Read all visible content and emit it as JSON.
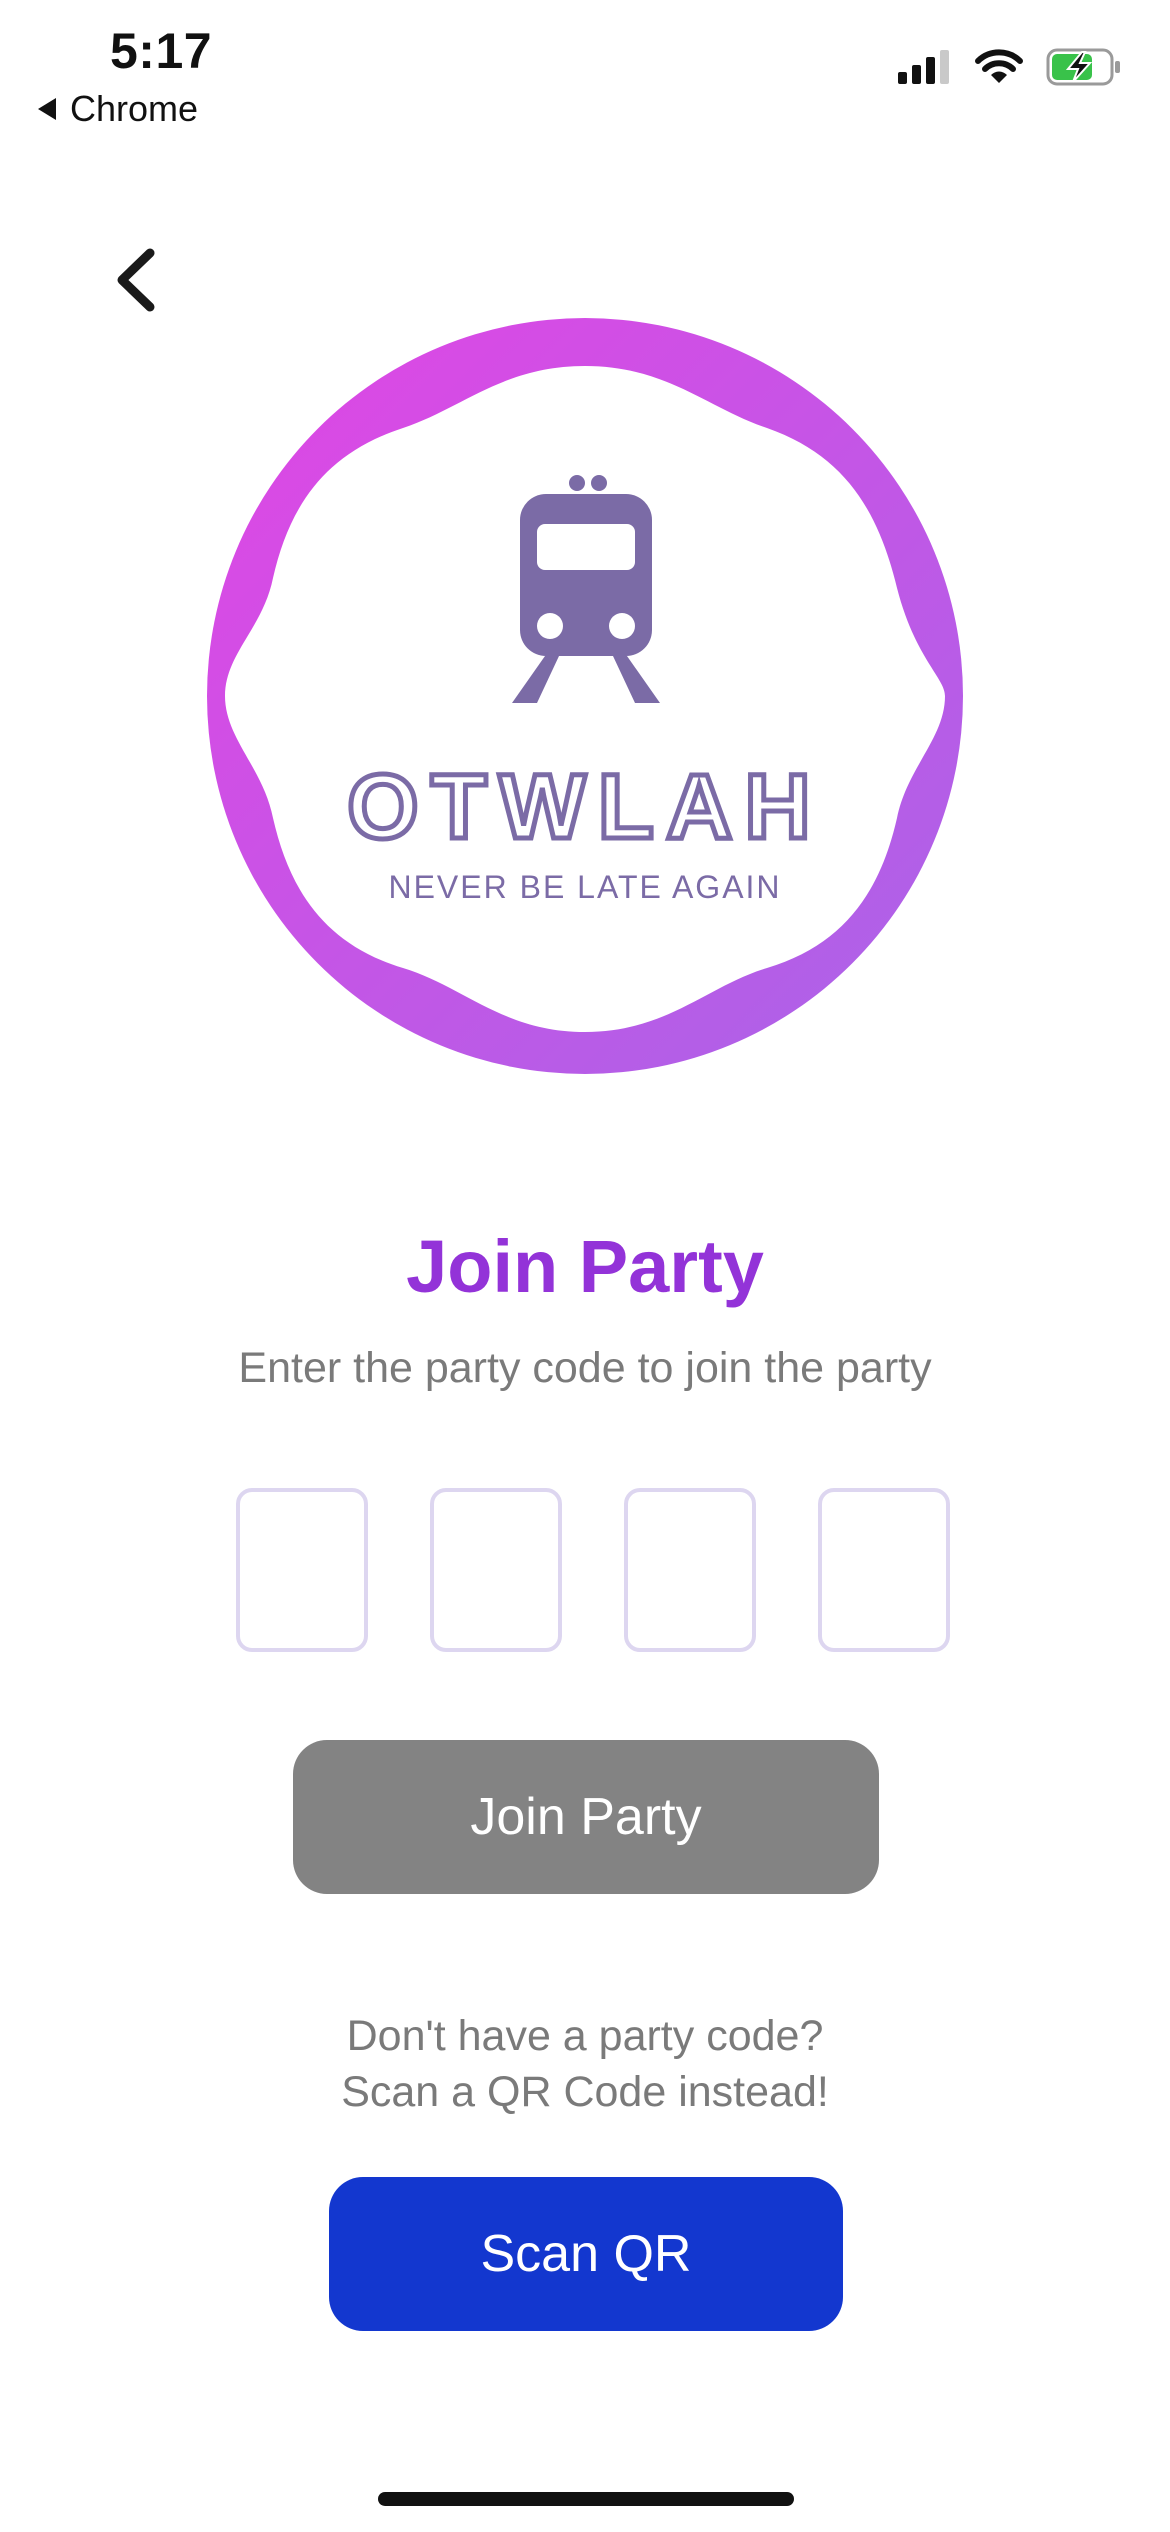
{
  "status_bar": {
    "time": "5:17",
    "back_app": "Chrome",
    "icons": [
      "cellular-signal-icon",
      "wifi-icon",
      "battery-charging-icon"
    ],
    "battery_color": "#39c24a"
  },
  "nav": {
    "back_icon": "chevron-left-icon"
  },
  "logo": {
    "brand": "OTWLAH",
    "tagline": "NEVER BE LATE AGAIN",
    "icon": "train-icon",
    "ring_gradient": [
      "#dd47e6",
      "#a964e8"
    ],
    "brand_color": "#7b6ba6"
  },
  "main": {
    "title": "Join Party",
    "subtitle": "Enter the party code to join the party",
    "code_boxes": [
      "",
      "",
      "",
      ""
    ],
    "join_button": "Join Party",
    "helper_line1": "Don't have a party code?",
    "helper_line2": "Scan a QR Code instead!",
    "scan_button": "Scan QR"
  },
  "colors": {
    "title": "#9333d8",
    "join_button_bg": "#838383",
    "scan_button_bg": "#1337cf",
    "code_box_border": "#ddd6f0"
  }
}
